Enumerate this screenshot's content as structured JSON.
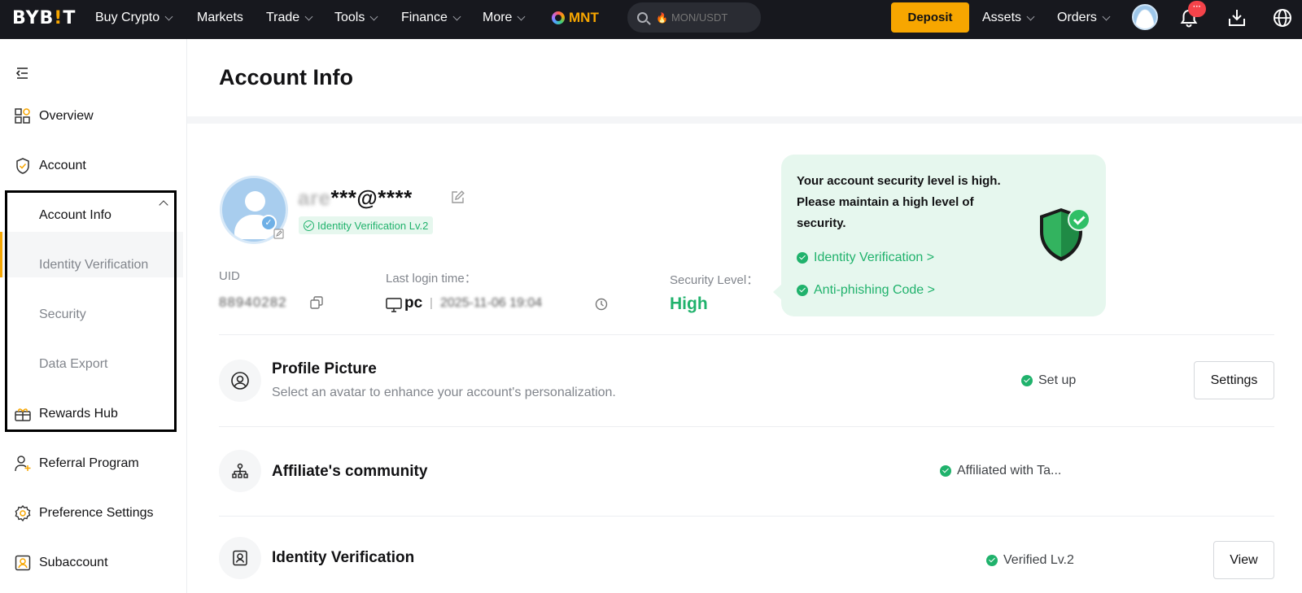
{
  "topnav": {
    "logo": "BYB!T",
    "items": [
      {
        "label": "Buy Crypto",
        "dropdown": true
      },
      {
        "label": "Markets",
        "dropdown": false
      },
      {
        "label": "Trade",
        "dropdown": true
      },
      {
        "label": "Tools",
        "dropdown": true
      },
      {
        "label": "Finance",
        "dropdown": true
      },
      {
        "label": "More",
        "dropdown": true
      }
    ],
    "mnt_label": "MNT",
    "search_placeholder": "MON/USDT",
    "deposit_label": "Deposit",
    "assets_label": "Assets",
    "orders_label": "Orders",
    "notification_badge": "···",
    "accent_color": "#f7a600"
  },
  "sidebar": {
    "items": [
      {
        "label": "Overview",
        "icon": "overview-icon"
      },
      {
        "label": "Account",
        "icon": "shield-check-icon",
        "expanded": true
      },
      {
        "label": "Rewards Hub",
        "icon": "gift-icon"
      },
      {
        "label": "Referral Program",
        "icon": "referral-icon"
      },
      {
        "label": "Preference Settings",
        "icon": "gear-icon"
      },
      {
        "label": "Subaccount",
        "icon": "subaccount-icon"
      }
    ],
    "account_subitems": [
      {
        "label": "Account Info",
        "active": true
      },
      {
        "label": "Identity Verification",
        "active": false
      },
      {
        "label": "Security",
        "active": false
      },
      {
        "label": "Data Export",
        "active": false
      }
    ]
  },
  "main": {
    "title": "Account Info",
    "profile": {
      "email_hidden_part": "are",
      "email_masked": "***@****",
      "kyc_chip": "Identity Verification Lv.2"
    },
    "meta": {
      "uid_label": "UID",
      "uid_value": "88940282",
      "login_label": "Last login time：",
      "login_device": "pc",
      "login_time": "2025-11-06 19:04",
      "security_label": "Security Level：",
      "security_value": "High"
    },
    "security_tip": {
      "text": "Your account security level is high. Please maintain a high level of security.",
      "links": [
        "Identity Verification >",
        "Anti-phishing Code >"
      ]
    },
    "rows": [
      {
        "title": "Profile Picture",
        "desc": "Select an avatar to enhance your account's personalization.",
        "status": "Set up",
        "button": "Settings"
      },
      {
        "title": "Affiliate's community",
        "desc": "",
        "status": "Affiliated with Ta...",
        "button": ""
      },
      {
        "title": "Identity Verification",
        "desc": "",
        "status": "Verified Lv.2",
        "button": "View"
      }
    ],
    "status_color": "#20b26c"
  }
}
